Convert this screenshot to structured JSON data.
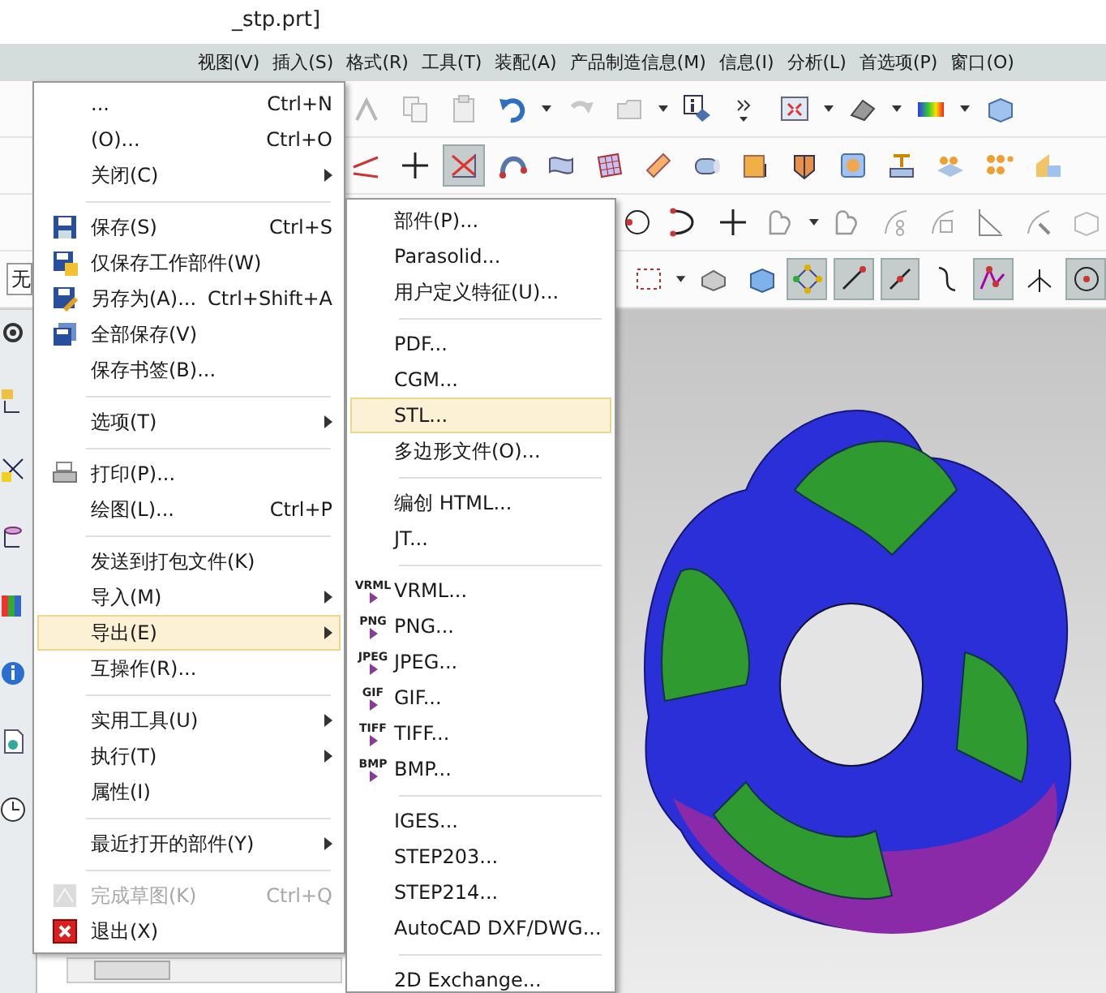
{
  "window": {
    "title": "_stp.prt]"
  },
  "menu_bar": [
    "视图(V)",
    "插入(S)",
    "格式(R)",
    "工具(T)",
    "装配(A)",
    "产品制造信息(M)",
    "信息(I)",
    "分析(L)",
    "首选项(P)",
    "窗口(O)"
  ],
  "toolbars": [
    {
      "buttons": [
        {
          "pressed": false
        },
        {
          "pressed": false
        },
        {
          "pressed": false
        },
        {
          "pressed": false
        },
        {
          "pressed": false
        },
        {
          "pressed": false
        },
        {
          "pressed": false
        },
        {
          "pressed": false
        },
        {
          "pressed": false
        },
        {
          "pressed": false
        },
        {
          "pressed": false
        },
        {
          "pressed": false
        }
      ]
    },
    {
      "buttons": [
        {
          "pressed": false
        },
        {
          "pressed": false
        },
        {
          "pressed": true
        },
        {
          "pressed": false
        },
        {
          "pressed": false
        },
        {
          "pressed": false
        },
        {
          "pressed": false
        },
        {
          "pressed": false
        },
        {
          "pressed": false
        },
        {
          "pressed": false
        },
        {
          "pressed": false
        },
        {
          "pressed": false
        },
        {
          "pressed": false
        },
        {
          "pressed": false
        },
        {
          "pressed": false
        }
      ]
    },
    {
      "buttons": [
        {
          "pressed": false
        },
        {
          "pressed": false
        },
        {
          "pressed": false
        },
        {
          "pressed": false
        },
        {
          "pressed": false
        },
        {
          "pressed": false
        },
        {
          "pressed": false
        },
        {
          "pressed": false
        },
        {
          "pressed": false
        },
        {
          "pressed": false
        }
      ]
    },
    {
      "buttons": [
        {
          "pressed": false
        },
        {
          "pressed": false
        },
        {
          "pressed": false
        },
        {
          "pressed": true
        },
        {
          "pressed": true
        },
        {
          "pressed": true
        },
        {
          "pressed": false
        },
        {
          "pressed": true
        },
        {
          "pressed": false
        },
        {
          "pressed": true
        }
      ]
    }
  ],
  "filter_combo": {
    "value": "无"
  },
  "file_menu": {
    "items": [
      {
        "kind": "item",
        "label": "...",
        "shortcut": "Ctrl+N",
        "submenu": false,
        "selected": false,
        "disabled": false
      },
      {
        "kind": "item",
        "label": "(O)...",
        "shortcut": "Ctrl+O",
        "submenu": false,
        "selected": false,
        "disabled": false
      },
      {
        "kind": "item",
        "label": "关闭(C)",
        "submenu": true,
        "selected": false,
        "disabled": false
      },
      {
        "kind": "separator"
      },
      {
        "kind": "item",
        "label": "保存(S)",
        "shortcut": "Ctrl+S",
        "submenu": false,
        "selected": false,
        "disabled": false
      },
      {
        "kind": "item",
        "label": "仅保存工作部件(W)",
        "submenu": false,
        "selected": false,
        "disabled": false
      },
      {
        "kind": "item",
        "label": "另存为(A)...",
        "shortcut": "Ctrl+Shift+A",
        "submenu": false,
        "selected": false,
        "disabled": false
      },
      {
        "kind": "item",
        "label": "全部保存(V)",
        "submenu": false,
        "selected": false,
        "disabled": false
      },
      {
        "kind": "item",
        "label": "保存书签(B)...",
        "submenu": false,
        "selected": false,
        "disabled": false
      },
      {
        "kind": "separator"
      },
      {
        "kind": "item",
        "label": "选项(T)",
        "submenu": true,
        "selected": false,
        "disabled": false
      },
      {
        "kind": "separator"
      },
      {
        "kind": "item",
        "label": "打印(P)...",
        "submenu": false,
        "selected": false,
        "disabled": false
      },
      {
        "kind": "item",
        "label": "绘图(L)...",
        "shortcut": "Ctrl+P",
        "submenu": false,
        "selected": false,
        "disabled": false
      },
      {
        "kind": "separator"
      },
      {
        "kind": "item",
        "label": "发送到打包文件(K)",
        "submenu": false,
        "selected": false,
        "disabled": false
      },
      {
        "kind": "item",
        "label": "导入(M)",
        "submenu": true,
        "selected": false,
        "disabled": false
      },
      {
        "kind": "item",
        "label": "导出(E)",
        "submenu": true,
        "selected": true,
        "disabled": false
      },
      {
        "kind": "item",
        "label": "互操作(R)...",
        "submenu": false,
        "selected": false,
        "disabled": false
      },
      {
        "kind": "separator"
      },
      {
        "kind": "item",
        "label": "实用工具(U)",
        "submenu": true,
        "selected": false,
        "disabled": false
      },
      {
        "kind": "item",
        "label": "执行(T)",
        "submenu": true,
        "selected": false,
        "disabled": false
      },
      {
        "kind": "item",
        "label": "属性(I)",
        "submenu": false,
        "selected": false,
        "disabled": false
      },
      {
        "kind": "separator"
      },
      {
        "kind": "item",
        "label": "最近打开的部件(Y)",
        "submenu": true,
        "selected": false,
        "disabled": false
      },
      {
        "kind": "separator"
      },
      {
        "kind": "item",
        "label": "完成草图(K)",
        "shortcut": "Ctrl+Q",
        "submenu": false,
        "selected": false,
        "disabled": true
      },
      {
        "kind": "item",
        "label": "退出(X)",
        "submenu": false,
        "selected": false,
        "disabled": false
      }
    ]
  },
  "export_menu": {
    "items": [
      {
        "kind": "item",
        "label": "部件(P)...",
        "selected": false
      },
      {
        "kind": "item",
        "label": "Parasolid...",
        "selected": false
      },
      {
        "kind": "item",
        "label": "用户定义特征(U)...",
        "selected": false
      },
      {
        "kind": "separator"
      },
      {
        "kind": "item",
        "label": "PDF...",
        "selected": false
      },
      {
        "kind": "item",
        "label": "CGM...",
        "selected": false
      },
      {
        "kind": "item",
        "label": "STL...",
        "selected": true
      },
      {
        "kind": "item",
        "label": "多边形文件(O)...",
        "selected": false
      },
      {
        "kind": "separator"
      },
      {
        "kind": "item",
        "label": "编创 HTML...",
        "selected": false
      },
      {
        "kind": "item",
        "label": "JT...",
        "selected": false
      },
      {
        "kind": "separator"
      },
      {
        "kind": "image",
        "tag": "VRML",
        "label": "VRML...",
        "selected": false
      },
      {
        "kind": "image",
        "tag": "PNG",
        "label": "PNG...",
        "selected": false
      },
      {
        "kind": "image",
        "tag": "JPEG",
        "label": "JPEG...",
        "selected": false
      },
      {
        "kind": "image",
        "tag": "GIF",
        "label": "GIF...",
        "selected": false
      },
      {
        "kind": "image",
        "tag": "TIFF",
        "label": "TIFF...",
        "selected": false
      },
      {
        "kind": "image",
        "tag": "BMP",
        "label": "BMP...",
        "selected": false
      },
      {
        "kind": "separator"
      },
      {
        "kind": "item",
        "label": "IGES...",
        "selected": false
      },
      {
        "kind": "item",
        "label": "STEP203...",
        "selected": false
      },
      {
        "kind": "item",
        "label": "STEP214...",
        "selected": false
      },
      {
        "kind": "item",
        "label": "AutoCAD DXF/DWG...",
        "selected": false
      },
      {
        "kind": "separator"
      },
      {
        "kind": "item",
        "label": "2D Exchange...",
        "selected": false
      }
    ]
  }
}
